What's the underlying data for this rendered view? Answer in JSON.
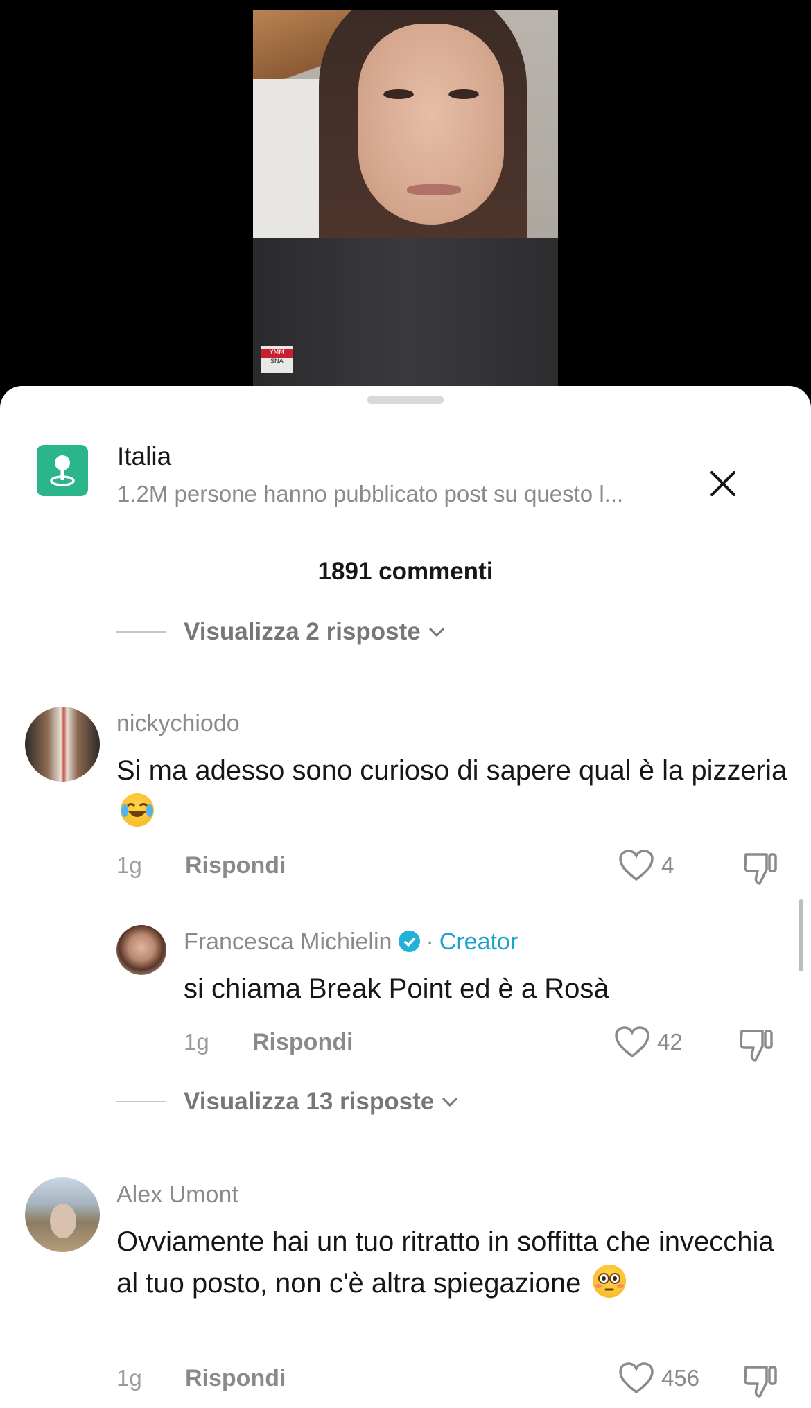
{
  "location": {
    "title": "Italia",
    "subtitle": "1.2M persone hanno pubblicato post su questo l...",
    "icon": "location-pin-icon",
    "icon_color": "#2bb58a"
  },
  "video": {
    "shirt_tag_top": "YMM",
    "shirt_tag_bottom": "SNA"
  },
  "comments_header": {
    "count_label": "1891 commenti"
  },
  "view_replies_top": {
    "label": "Visualizza 2 risposte"
  },
  "comments": [
    {
      "username": "nickychiodo",
      "text": "Si ma adesso sono curioso di sapere qual è la pizzeria",
      "emoji": "face-with-tears-of-joy",
      "time": "1g",
      "reply_label": "Rispondi",
      "likes": "4"
    },
    {
      "username": "Francesca Michielin",
      "verified": true,
      "separator": "·",
      "creator_label": "Creator",
      "text": "si chiama Break Point ed è a Rosà",
      "time": "1g",
      "reply_label": "Rispondi",
      "likes": "42"
    },
    {
      "username": "Alex Umont",
      "text": "Ovviamente hai un tuo ritratto in soffitta che invecchia al tuo posto, non c'è altra spiegazione",
      "emoji": "flushed-face",
      "time": "1g",
      "reply_label": "Rispondi",
      "likes": "456"
    }
  ],
  "view_replies_mid": {
    "label": "Visualizza 13 risposte"
  },
  "colors": {
    "accent_creator": "#1aa3cf",
    "verified_badge": "#20b2d8"
  }
}
